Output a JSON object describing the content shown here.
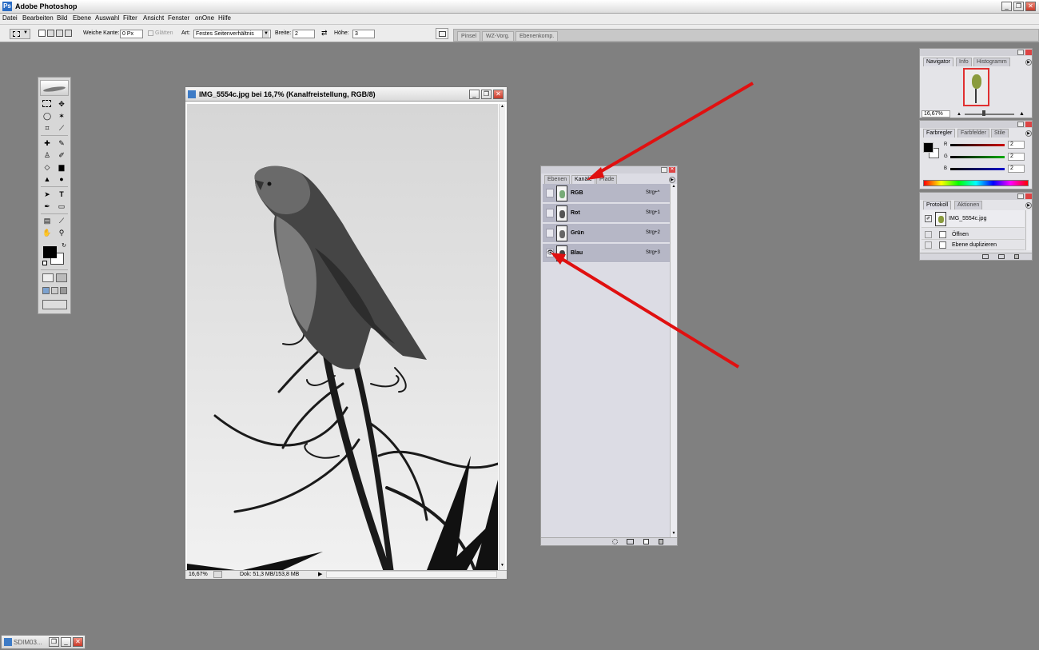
{
  "app": {
    "title": "Adobe Photoshop",
    "logo": "Ps"
  },
  "window_controls": {
    "minimize": "_",
    "restore": "❐",
    "close": "✕"
  },
  "menu": [
    "Datei",
    "Bearbeiten",
    "Bild",
    "Ebene",
    "Auswahl",
    "Filter",
    "Ansicht",
    "Fenster",
    "onOne",
    "Hilfe"
  ],
  "options": {
    "feather_label": "Weiche Kante:",
    "feather_value": "0 Px",
    "smooth_label": "Glätten",
    "style_label": "Art:",
    "style_value": "Festes Seitenverhältnis",
    "width_label": "Breite:",
    "width_value": "2",
    "height_label": "Höhe:",
    "height_value": "3",
    "swap_symbol": "⇄"
  },
  "palette_well": [
    "Pinsel",
    "WZ-Vorg.",
    "Ebenenkomp."
  ],
  "document": {
    "title": "IMG_5554c.jpg bei 16,7% (Kanalfreistellung, RGB/8)",
    "zoom": "16,67%",
    "doc_info": "Dok: 51,3 MB/153,8 MB",
    "status_arrow": "▶"
  },
  "channels_panel": {
    "tabs": [
      "Ebenen",
      "Kanäle",
      "Pfade"
    ],
    "active_tab": "Kanäle",
    "channels": [
      {
        "name": "RGB",
        "shortcut": "Strg+^",
        "visible": false
      },
      {
        "name": "Rot",
        "shortcut": "Strg+1",
        "visible": false
      },
      {
        "name": "Grün",
        "shortcut": "Strg+2",
        "visible": false
      },
      {
        "name": "Blau",
        "shortcut": "Strg+3",
        "visible": true
      }
    ],
    "eye_symbol": "👁",
    "footer_icons": [
      "dotted-circle-icon",
      "mask-icon",
      "new-channel-icon",
      "trash-icon"
    ]
  },
  "navigator_panel": {
    "tabs": [
      "Navigator",
      "Info",
      "Histogramm"
    ],
    "zoom": "16,67%"
  },
  "color_panel": {
    "tabs": [
      "Farbregler",
      "Farbfelder",
      "Stile"
    ],
    "sliders": [
      {
        "label": "R",
        "value": "2",
        "color": "#cc0000"
      },
      {
        "label": "G",
        "value": "2",
        "color": "#00aa00"
      },
      {
        "label": "B",
        "value": "2",
        "color": "#0000cc"
      }
    ]
  },
  "history_panel": {
    "tabs": [
      "Protokoll",
      "Aktionen"
    ],
    "snapshot": "IMG_5554c.jpg",
    "items": [
      "Öffnen",
      "Ebene duplizieren"
    ]
  },
  "minimized_doc": {
    "label": "SDIM03..."
  },
  "annotation_color": "#e01010"
}
